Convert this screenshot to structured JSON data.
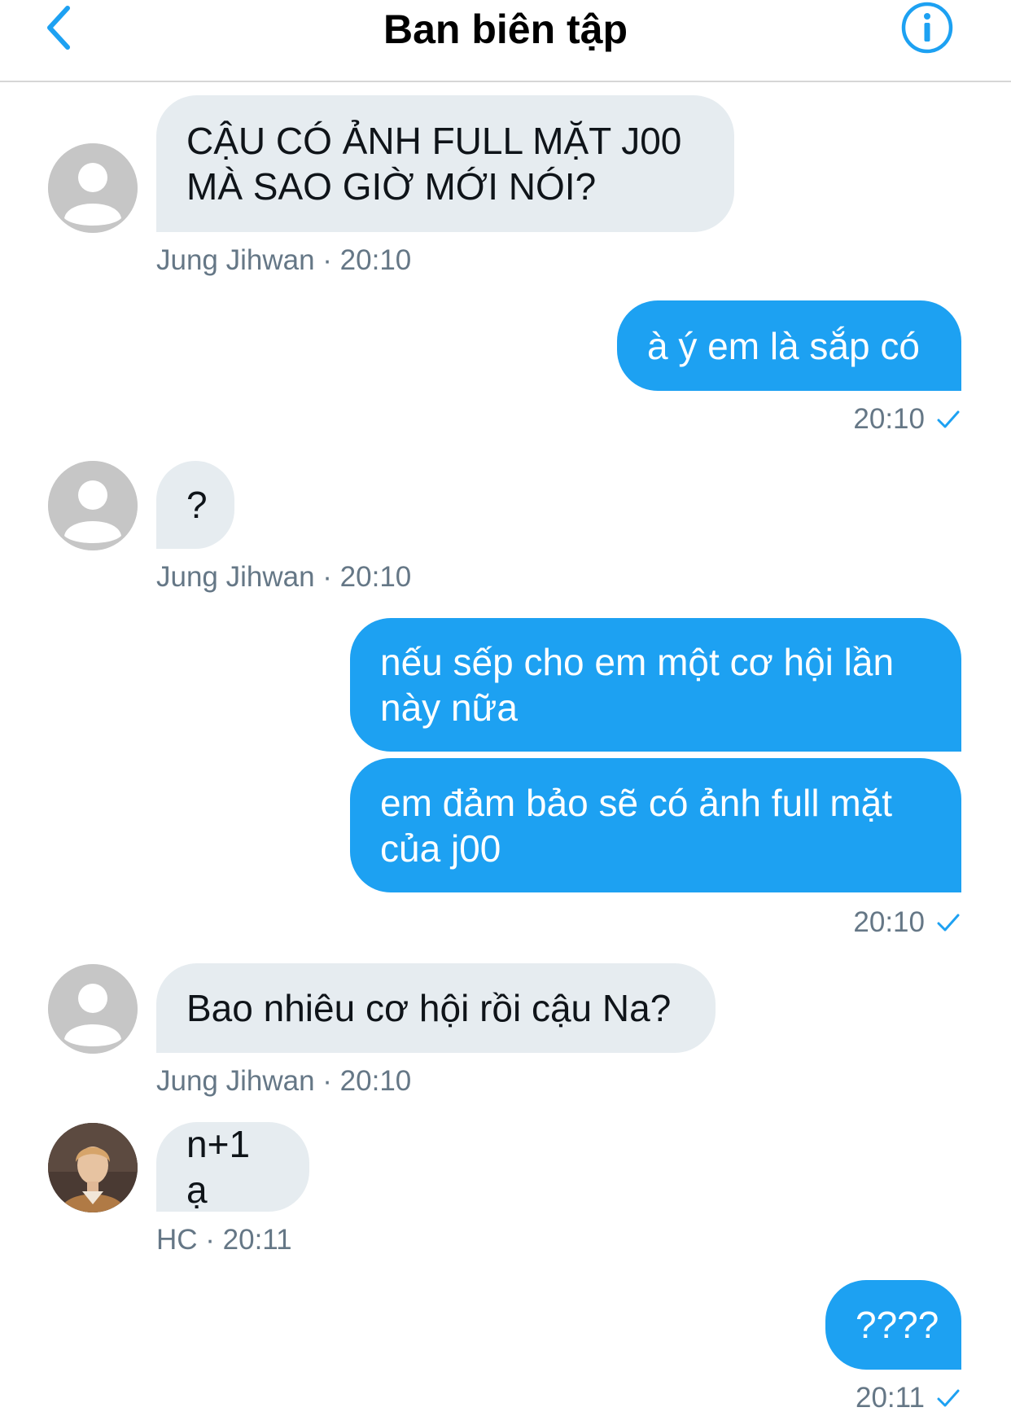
{
  "header": {
    "title": "Ban biên tập",
    "back_icon": "chevron-left-icon",
    "info_icon": "info-icon",
    "accent_color": "#1da1f2"
  },
  "messages": [
    {
      "direction": "in",
      "avatar": "default-avatar",
      "text": "CẬU CÓ ẢNH FULL MẶT J00\nMÀ SAO GIỜ MỚI NÓI?",
      "meta": "Jung Jihwan · 20:10"
    },
    {
      "direction": "out",
      "text": "à ý em là sắp có",
      "meta": "20:10",
      "status_icon": "check-icon"
    },
    {
      "direction": "in",
      "avatar": "default-avatar",
      "text": "?",
      "meta": "Jung Jihwan · 20:10"
    },
    {
      "direction": "out",
      "text": "nếu sếp cho em một cơ hội lần\nnày nữa"
    },
    {
      "direction": "out",
      "text": "em đảm bảo sẽ có ảnh full mặt\ncủa j00",
      "meta": "20:10",
      "status_icon": "check-icon"
    },
    {
      "direction": "in",
      "avatar": "default-avatar",
      "text": "Bao nhiêu cơ hội rồi cậu Na?",
      "meta": "Jung Jihwan · 20:10"
    },
    {
      "direction": "in",
      "avatar": "profile-photo",
      "text": "n+1 ạ",
      "meta": "HC · 20:11"
    },
    {
      "direction": "out",
      "text": "????",
      "meta": "20:11",
      "status_icon": "check-icon"
    }
  ],
  "colors": {
    "outgoing_bubble": "#1da1f2",
    "incoming_bubble": "#e6ecf0",
    "meta_text": "#657786"
  }
}
